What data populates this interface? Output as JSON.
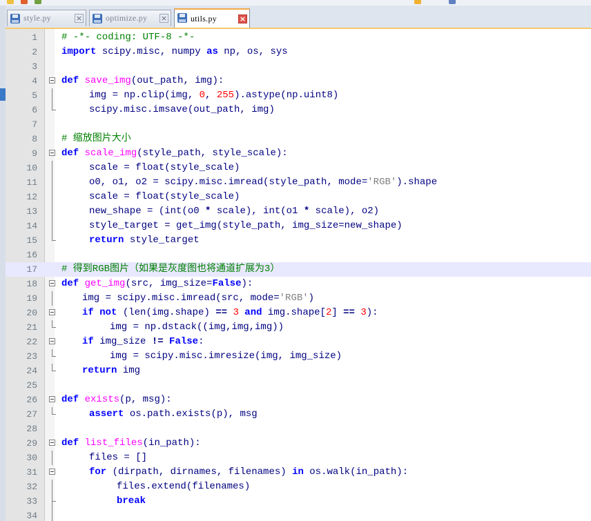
{
  "window": {
    "accent_color": "#f2a84a",
    "tab_bar_color": "#dfe5ee",
    "close_active_color": "#e0544c"
  },
  "tabs": [
    {
      "label": "style.py",
      "active": false,
      "icon": "floppy-disk-icon"
    },
    {
      "label": "optimize.py",
      "active": false,
      "icon": "floppy-disk-icon"
    },
    {
      "label": "utils.py",
      "active": true,
      "icon": "floppy-disk-icon"
    }
  ],
  "editor": {
    "language": "python",
    "current_line": 17,
    "lines": [
      {
        "n": "1",
        "fold": "",
        "indent": 0,
        "tokens": [
          {
            "t": "# -*- coding: UTF-8 -*-",
            "c": "com"
          }
        ]
      },
      {
        "n": "2",
        "fold": "",
        "indent": 0,
        "tokens": [
          {
            "t": "import",
            "c": "kw"
          },
          {
            "t": " scipy.misc, numpy ",
            "c": ""
          },
          {
            "t": "as",
            "c": "kw"
          },
          {
            "t": " np, os, sys",
            "c": ""
          }
        ]
      },
      {
        "n": "3",
        "fold": "",
        "indent": 0,
        "tokens": []
      },
      {
        "n": "4",
        "fold": "box",
        "indent": 0,
        "tokens": [
          {
            "t": "def",
            "c": "kw"
          },
          {
            "t": " ",
            "c": ""
          },
          {
            "t": "save_img",
            "c": "func"
          },
          {
            "t": "(out_path, img):",
            "c": ""
          }
        ]
      },
      {
        "n": "5",
        "fold": "vline",
        "indent": 4,
        "tokens": [
          {
            "t": "img = np.clip(img, ",
            "c": ""
          },
          {
            "t": "0",
            "c": "num"
          },
          {
            "t": ", ",
            "c": ""
          },
          {
            "t": "255",
            "c": "num"
          },
          {
            "t": ").astype(np.uint8)",
            "c": ""
          }
        ]
      },
      {
        "n": "6",
        "fold": "end",
        "indent": 4,
        "tokens": [
          {
            "t": "scipy.misc.imsave(out_path, img)",
            "c": ""
          }
        ]
      },
      {
        "n": "7",
        "fold": "",
        "indent": 0,
        "tokens": []
      },
      {
        "n": "8",
        "fold": "",
        "indent": 0,
        "tokens": [
          {
            "t": "# 缩放图片大小",
            "c": "com"
          }
        ]
      },
      {
        "n": "9",
        "fold": "box",
        "indent": 0,
        "tokens": [
          {
            "t": "def",
            "c": "kw"
          },
          {
            "t": " ",
            "c": ""
          },
          {
            "t": "scale_img",
            "c": "func"
          },
          {
            "t": "(style_path, style_scale):",
            "c": ""
          }
        ]
      },
      {
        "n": "10",
        "fold": "vline",
        "indent": 4,
        "tokens": [
          {
            "t": "scale = float(style_scale)",
            "c": ""
          }
        ]
      },
      {
        "n": "11",
        "fold": "vline",
        "indent": 4,
        "tokens": [
          {
            "t": "o0, o1, o2 = scipy.misc.imread(style_path, mode=",
            "c": ""
          },
          {
            "t": "'RGB'",
            "c": "str"
          },
          {
            "t": ").shape",
            "c": ""
          }
        ]
      },
      {
        "n": "12",
        "fold": "vline",
        "indent": 4,
        "tokens": [
          {
            "t": "scale = float(style_scale)",
            "c": ""
          }
        ]
      },
      {
        "n": "13",
        "fold": "vline",
        "indent": 4,
        "tokens": [
          {
            "t": "new_shape = (int(o0 ",
            "c": ""
          },
          {
            "t": "*",
            "c": "op"
          },
          {
            "t": " scale), int(o1 ",
            "c": ""
          },
          {
            "t": "*",
            "c": "op"
          },
          {
            "t": " scale), o2)",
            "c": ""
          }
        ]
      },
      {
        "n": "14",
        "fold": "vline",
        "indent": 4,
        "tokens": [
          {
            "t": "style_target = get_img(style_path, img_size=new_shape)",
            "c": ""
          }
        ]
      },
      {
        "n": "15",
        "fold": "end",
        "indent": 4,
        "tokens": [
          {
            "t": "return",
            "c": "kw"
          },
          {
            "t": " style_target",
            "c": ""
          }
        ]
      },
      {
        "n": "16",
        "fold": "",
        "indent": 0,
        "tokens": []
      },
      {
        "n": "17",
        "fold": "",
        "indent": 0,
        "tokens": [
          {
            "t": "# 得到RGB图片（如果是灰度图也将通道扩展为3）",
            "c": "com"
          }
        ]
      },
      {
        "n": "18",
        "fold": "box",
        "indent": 0,
        "tokens": [
          {
            "t": "def",
            "c": "kw"
          },
          {
            "t": " ",
            "c": ""
          },
          {
            "t": "get_img",
            "c": "func"
          },
          {
            "t": "(src, img_size=",
            "c": ""
          },
          {
            "t": "False",
            "c": "kw"
          },
          {
            "t": "):",
            "c": ""
          }
        ]
      },
      {
        "n": "19",
        "fold": "vline",
        "indent": 3,
        "tokens": [
          {
            "t": "img = scipy.misc.imread(src, mode=",
            "c": ""
          },
          {
            "t": "'RGB'",
            "c": "str"
          },
          {
            "t": ")",
            "c": ""
          }
        ]
      },
      {
        "n": "20",
        "fold": "box",
        "indent": 3,
        "tokens": [
          {
            "t": "if",
            "c": "kw"
          },
          {
            "t": " ",
            "c": ""
          },
          {
            "t": "not",
            "c": "kw"
          },
          {
            "t": " (len(img.shape) ",
            "c": ""
          },
          {
            "t": "==",
            "c": "op"
          },
          {
            "t": " ",
            "c": ""
          },
          {
            "t": "3",
            "c": "num"
          },
          {
            "t": " ",
            "c": ""
          },
          {
            "t": "and",
            "c": "kw"
          },
          {
            "t": " img.shape[",
            "c": ""
          },
          {
            "t": "2",
            "c": "num"
          },
          {
            "t": "] ",
            "c": ""
          },
          {
            "t": "==",
            "c": "op"
          },
          {
            "t": " ",
            "c": ""
          },
          {
            "t": "3",
            "c": "num"
          },
          {
            "t": "):",
            "c": ""
          }
        ]
      },
      {
        "n": "21",
        "fold": "end",
        "indent": 7,
        "tokens": [
          {
            "t": "img = np.dstack((img,img,img))",
            "c": ""
          }
        ]
      },
      {
        "n": "22",
        "fold": "box",
        "indent": 3,
        "tokens": [
          {
            "t": "if",
            "c": "kw"
          },
          {
            "t": " img_size ",
            "c": ""
          },
          {
            "t": "!=",
            "c": "op"
          },
          {
            "t": " ",
            "c": ""
          },
          {
            "t": "False",
            "c": "kw"
          },
          {
            "t": ":",
            "c": ""
          }
        ]
      },
      {
        "n": "23",
        "fold": "end",
        "indent": 7,
        "tokens": [
          {
            "t": "img = scipy.misc.imresize(img, img_size)",
            "c": ""
          }
        ]
      },
      {
        "n": "24",
        "fold": "end",
        "indent": 3,
        "tokens": [
          {
            "t": "return",
            "c": "kw"
          },
          {
            "t": " img",
            "c": ""
          }
        ]
      },
      {
        "n": "25",
        "fold": "",
        "indent": 0,
        "tokens": []
      },
      {
        "n": "26",
        "fold": "box",
        "indent": 0,
        "tokens": [
          {
            "t": "def",
            "c": "kw"
          },
          {
            "t": " ",
            "c": ""
          },
          {
            "t": "exists",
            "c": "func"
          },
          {
            "t": "(p, msg):",
            "c": ""
          }
        ]
      },
      {
        "n": "27",
        "fold": "end",
        "indent": 4,
        "tokens": [
          {
            "t": "assert",
            "c": "kw"
          },
          {
            "t": " os.path.exists(p), msg",
            "c": ""
          }
        ]
      },
      {
        "n": "28",
        "fold": "",
        "indent": 0,
        "tokens": []
      },
      {
        "n": "29",
        "fold": "box",
        "indent": 0,
        "tokens": [
          {
            "t": "def",
            "c": "kw"
          },
          {
            "t": " ",
            "c": ""
          },
          {
            "t": "list_files",
            "c": "func"
          },
          {
            "t": "(in_path):",
            "c": ""
          }
        ]
      },
      {
        "n": "30",
        "fold": "vline",
        "indent": 4,
        "tokens": [
          {
            "t": "files = []",
            "c": ""
          }
        ]
      },
      {
        "n": "31",
        "fold": "box",
        "indent": 4,
        "tokens": [
          {
            "t": "for",
            "c": "kw"
          },
          {
            "t": " (dirpath, dirnames, filenames) ",
            "c": ""
          },
          {
            "t": "in",
            "c": "kw"
          },
          {
            "t": " os.walk(in_path):",
            "c": ""
          }
        ]
      },
      {
        "n": "32",
        "fold": "vline",
        "indent": 8,
        "tokens": [
          {
            "t": "files.extend(filenames)",
            "c": ""
          }
        ]
      },
      {
        "n": "33",
        "fold": "mid",
        "indent": 8,
        "tokens": [
          {
            "t": "break",
            "c": "kw"
          }
        ]
      },
      {
        "n": "34",
        "fold": "vline",
        "indent": 0,
        "tokens": []
      }
    ]
  }
}
